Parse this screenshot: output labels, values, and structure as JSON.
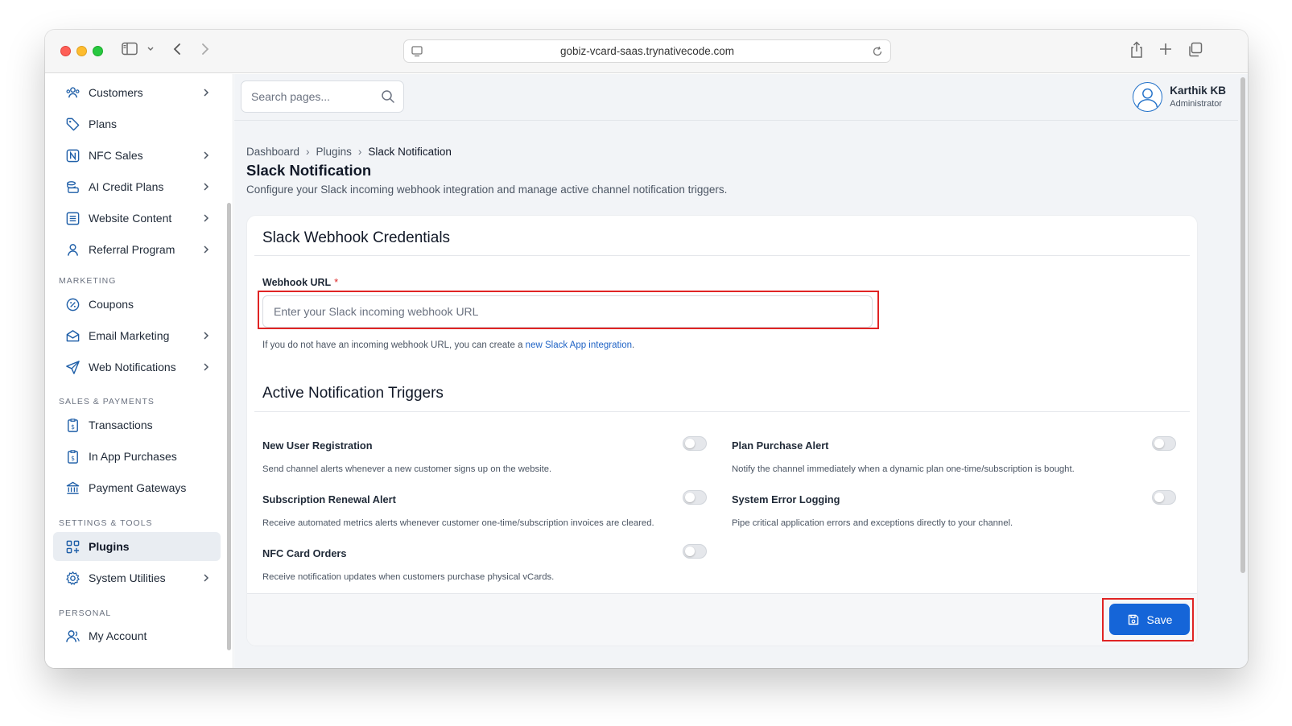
{
  "browser": {
    "url": "gobiz-vcard-saas.trynativecode.com"
  },
  "sidebar": {
    "items": [
      {
        "label": "Customers",
        "icon": "users-icon",
        "chevron": true
      },
      {
        "label": "Plans",
        "icon": "tag-icon",
        "chevron": false
      },
      {
        "label": "NFC Sales",
        "icon": "nfc-icon",
        "chevron": true
      },
      {
        "label": "AI Credit Plans",
        "icon": "coins-icon",
        "chevron": true
      },
      {
        "label": "Website Content",
        "icon": "document-icon",
        "chevron": true
      },
      {
        "label": "Referral Program",
        "icon": "user-icon",
        "chevron": true
      }
    ],
    "sections": {
      "marketing": "MARKETING",
      "sales_payments": "SALES & PAYMENTS",
      "settings_tools": "SETTINGS & TOOLS",
      "personal": "PERSONAL"
    },
    "marketing_items": [
      {
        "label": "Coupons",
        "icon": "coupon-icon"
      },
      {
        "label": "Email Marketing",
        "icon": "mail-icon"
      },
      {
        "label": "Web Notifications",
        "icon": "send-icon"
      }
    ],
    "sales_items": [
      {
        "label": "Transactions",
        "icon": "receipt-icon"
      },
      {
        "label": "In App Purchases",
        "icon": "receipt-icon"
      },
      {
        "label": "Payment Gateways",
        "icon": "bank-icon"
      }
    ],
    "settings_items": [
      {
        "label": "Plugins",
        "icon": "plugins-icon",
        "active": true
      },
      {
        "label": "System Utilities",
        "icon": "gear-icon"
      }
    ],
    "personal_items": [
      {
        "label": "My Account",
        "icon": "account-icon"
      }
    ]
  },
  "topbar": {
    "search_placeholder": "Search pages...",
    "user_name": "Karthik KB",
    "user_role": "Administrator"
  },
  "breadcrumb": [
    "Dashboard",
    "Plugins",
    "Slack Notification"
  ],
  "page": {
    "title": "Slack Notification",
    "description": "Configure your Slack incoming webhook integration and manage active channel notification triggers."
  },
  "credentials": {
    "title": "Slack Webhook Credentials",
    "webhook_label": "Webhook URL",
    "required_mark": "*",
    "webhook_placeholder": "Enter your Slack incoming webhook URL",
    "webhook_value": "",
    "hint_prefix": "If you do not have an incoming webhook URL, you can create a ",
    "hint_link": "new Slack App integration",
    "hint_suffix": "."
  },
  "triggers": {
    "title": "Active Notification Triggers",
    "items": [
      {
        "title": "New User Registration",
        "description": "Send channel alerts whenever a new customer signs up on the website.",
        "enabled": false
      },
      {
        "title": "Plan Purchase Alert",
        "description": "Notify the channel immediately when a dynamic plan one-time/subscription is bought.",
        "enabled": false
      },
      {
        "title": "Subscription Renewal Alert",
        "description": "Receive automated metrics alerts whenever customer one-time/subscription invoices are cleared.",
        "enabled": false
      },
      {
        "title": "System Error Logging",
        "description": "Pipe critical application errors and exceptions directly to your channel.",
        "enabled": false
      },
      {
        "title": "NFC Card Orders",
        "description": "Receive notification updates when customers purchase physical vCards.",
        "enabled": false
      }
    ]
  },
  "footer": {
    "save_label": "Save"
  },
  "colors": {
    "primary": "#1565d8",
    "highlight": "#e02424",
    "link": "#1f63c5"
  }
}
